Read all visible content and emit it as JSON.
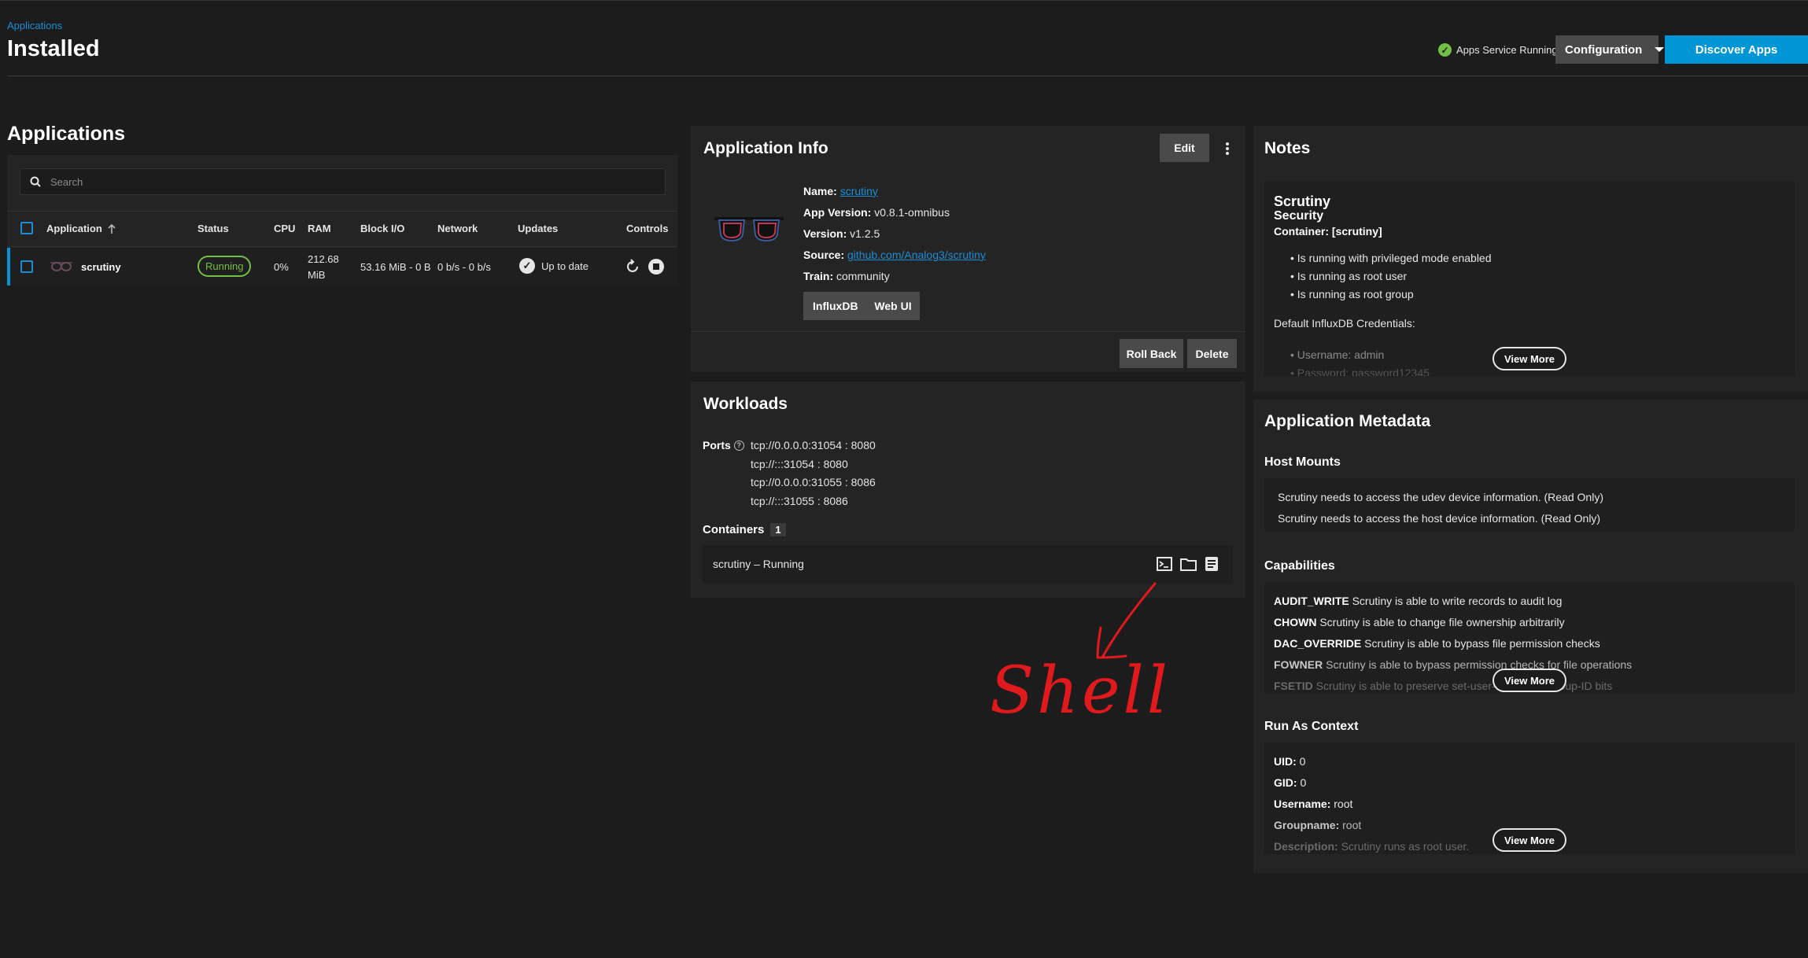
{
  "header": {
    "breadcrumb": "Applications",
    "title": "Installed",
    "service_status": "Apps Service Running",
    "config_label": "Configuration",
    "discover_label": "Discover Apps"
  },
  "apps": {
    "title": "Applications",
    "search_placeholder": "Search",
    "columns": [
      "Application",
      "Status",
      "CPU",
      "RAM",
      "Block I/O",
      "Network",
      "Updates",
      "Controls"
    ],
    "row": {
      "name": "scrutiny",
      "status": "Running",
      "cpu": "0%",
      "ram_line1": "212.68",
      "ram_line2": "MiB",
      "block_io": "53.16 MiB - 0 B",
      "network": "0 b/s - 0 b/s",
      "updates": "Up to date"
    }
  },
  "app_info": {
    "title": "Application Info",
    "edit_label": "Edit",
    "name_label": "Name:",
    "name_value": "scrutiny",
    "app_version_label": "App Version:",
    "app_version_value": "v0.8.1-omnibus",
    "version_label": "Version:",
    "version_value": "v1.2.5",
    "source_label": "Source:",
    "source_value": "github.com/Analog3/scrutiny",
    "train_label": "Train:",
    "train_value": "community",
    "portal_influx": "InfluxDB",
    "portal_webui": "Web UI",
    "rollback_label": "Roll Back",
    "delete_label": "Delete"
  },
  "workloads": {
    "title": "Workloads",
    "ports_label": "Ports",
    "ports": [
      "tcp://0.0.0.0:31054 : 8080",
      "tcp://:::31054 : 8080",
      "tcp://0.0.0.0:31055 : 8086",
      "tcp://:::31055 : 8086"
    ],
    "containers_label": "Containers",
    "containers_count": "1",
    "container_row": "scrutiny  –  Running"
  },
  "annotation": {
    "text": "Shell",
    "color": "#e0191d"
  },
  "notes": {
    "title": "Notes",
    "app_name": "Scrutiny",
    "security_heading": "Security",
    "container_line": "Container: [scrutiny]",
    "bullets": [
      "Is running with privileged mode enabled",
      "Is running as root user",
      "Is running as root group"
    ],
    "creds_heading": "Default InfluxDB Credentials:",
    "cred_user": "Username: admin",
    "cred_pass": "Password: password12345",
    "view_more": "View More"
  },
  "metadata": {
    "title": "Application Metadata",
    "host_mounts_title": "Host Mounts",
    "host_mounts": [
      "Scrutiny needs to access the udev device information. (Read Only)",
      "Scrutiny needs to access the host device information. (Read Only)"
    ],
    "capabilities_title": "Capabilities",
    "capabilities": [
      {
        "name": "AUDIT_WRITE",
        "desc": "Scrutiny is able to write records to audit log"
      },
      {
        "name": "CHOWN",
        "desc": "Scrutiny is able to change file ownership arbitrarily"
      },
      {
        "name": "DAC_OVERRIDE",
        "desc": "Scrutiny is able to bypass file permission checks"
      },
      {
        "name": "FOWNER",
        "desc": "Scrutiny is able to bypass permission checks for file operations"
      },
      {
        "name": "FSETID",
        "desc": "Scrutiny is able to preserve set-user-ID and set-group-ID bits"
      }
    ],
    "run_as_title": "Run As Context",
    "uid_label": "UID:",
    "uid_value": "0",
    "gid_label": "GID:",
    "gid_value": "0",
    "username_label": "Username:",
    "username_value": "root",
    "groupname_label": "Groupname:",
    "groupname_value": "root",
    "description_label": "Description:",
    "description_value": "Scrutiny runs as root user.",
    "view_more": "View More"
  },
  "colors": {
    "accent": "#0095d5",
    "running": "#71bf44"
  }
}
